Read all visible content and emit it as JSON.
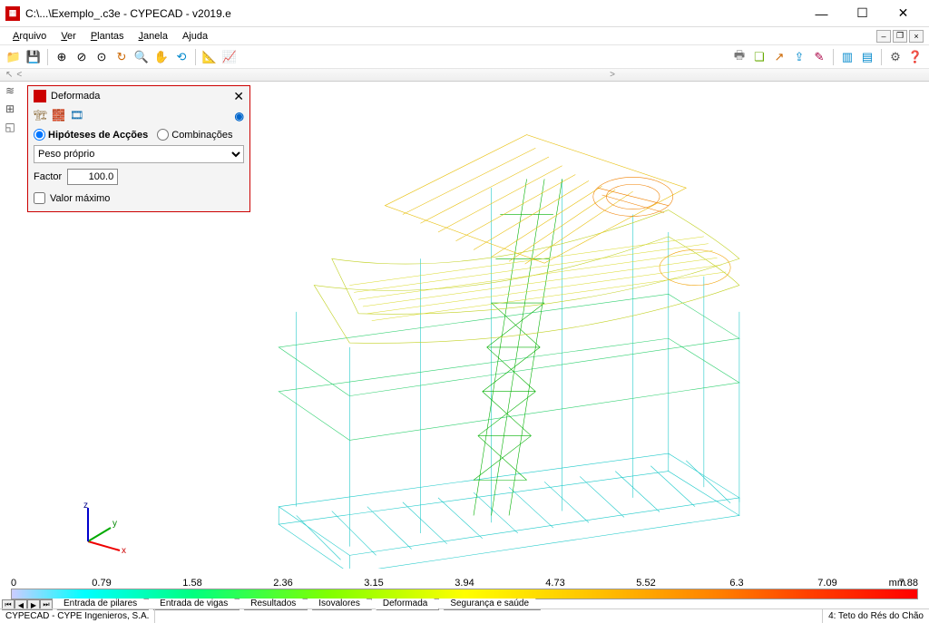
{
  "window": {
    "title": "C:\\...\\Exemplo_.c3e - CYPECAD - v2019.e"
  },
  "menu": {
    "arquivo": "Arquivo",
    "ver": "Ver",
    "plantas": "Plantas",
    "janela": "Janela",
    "ajuda": "Ajuda"
  },
  "panel": {
    "title": "Deformada",
    "hipoteses": "Hipóteses de Acções",
    "combinacoes": "Combinações",
    "select_value": "Peso próprio",
    "factor_label": "Factor",
    "factor_value": "100.0",
    "valor_maximo": "Valor máximo"
  },
  "scale": {
    "v0": "0",
    "v1": "0.79",
    "v2": "1.58",
    "v3": "2.36",
    "v4": "3.15",
    "v5": "3.94",
    "v6": "4.73",
    "v7": "5.52",
    "v8": "6.3",
    "v9": "7.09",
    "v10": "7.88",
    "unit": "mm"
  },
  "axes": {
    "x": "x",
    "y": "y",
    "z": "z"
  },
  "tabs": {
    "pilares": "Entrada de pilares",
    "vigas": "Entrada de vigas",
    "resultados": "Resultados",
    "isovalores": "Isovalores",
    "deformada": "Deformada",
    "seguranca": "Segurança e saúde"
  },
  "status": {
    "company": "CYPECAD - CYPE Ingenieros, S.A.",
    "floor": "4: Teto do Rés do Chão"
  }
}
